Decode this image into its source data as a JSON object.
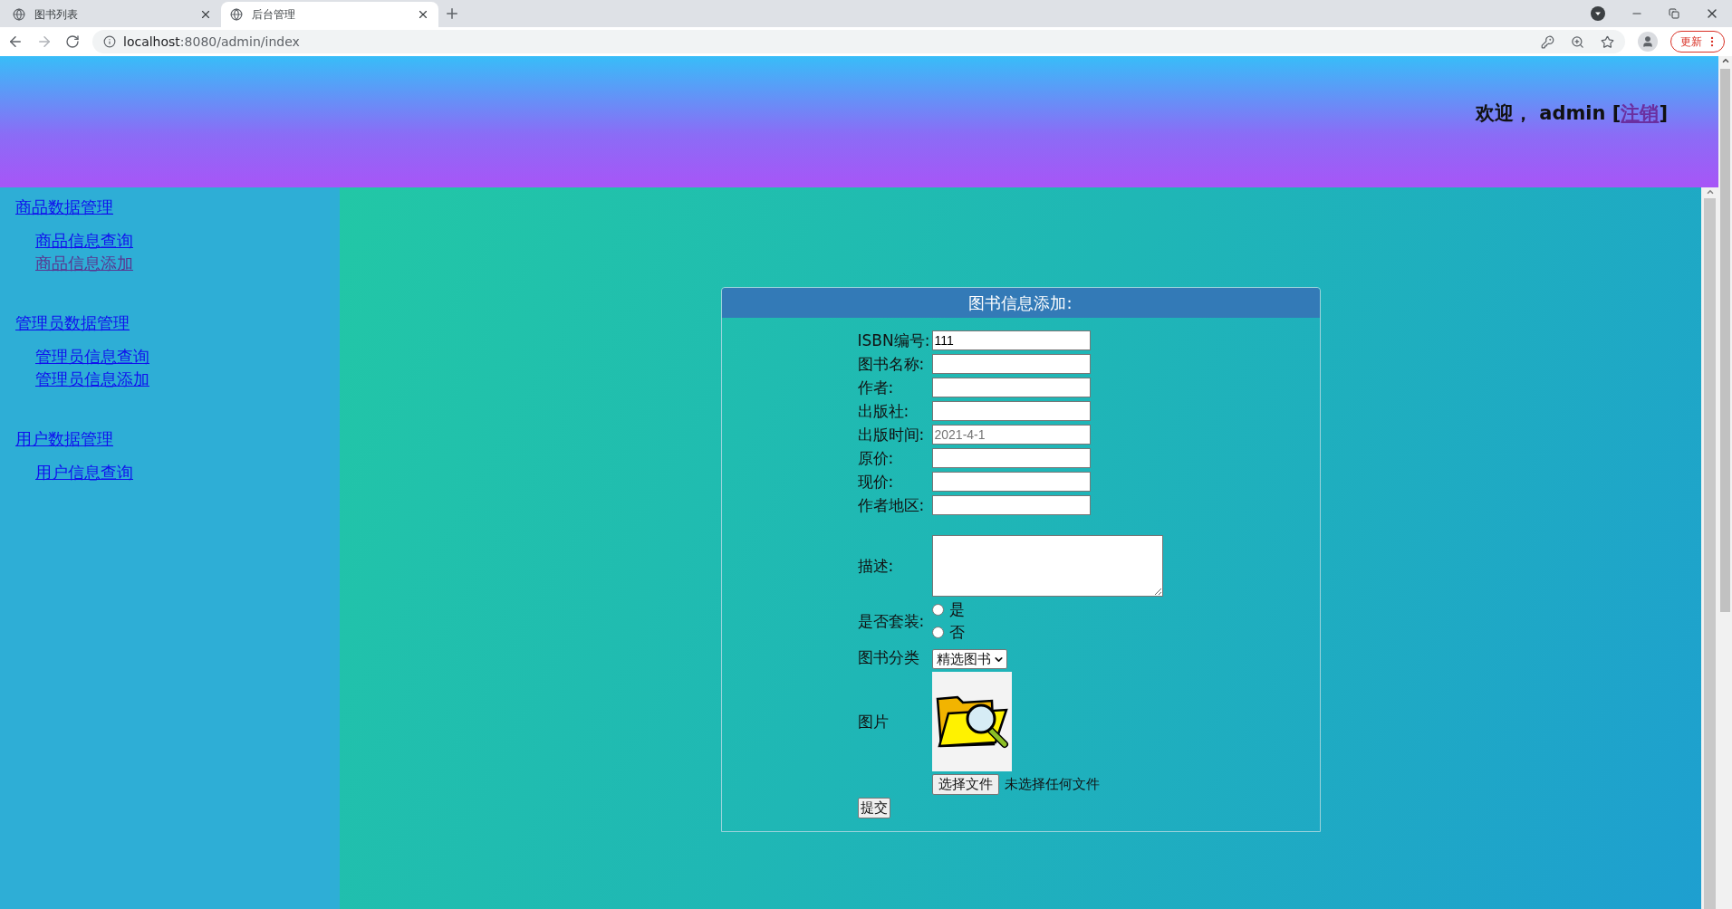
{
  "browser": {
    "tabs": [
      {
        "title": "图书列表",
        "selected": false
      },
      {
        "title": "后台管理",
        "selected": true
      }
    ],
    "url_host": "localhost",
    "url_path": ":8080/admin/index",
    "update_button": "更新"
  },
  "header": {
    "greeting_before": "欢迎， admin [",
    "logout_link": "注销",
    "greeting_after": "]"
  },
  "sidebar": {
    "groups": [
      {
        "title": "商品数据管理",
        "children": [
          {
            "label": "商品信息查询",
            "visited": false
          },
          {
            "label": "商品信息添加",
            "visited": true
          }
        ]
      },
      {
        "title": "管理员数据管理",
        "children": [
          {
            "label": "管理员信息查询",
            "visited": false
          },
          {
            "label": "管理员信息添加",
            "visited": false
          }
        ]
      },
      {
        "title": "用户数据管理",
        "children": [
          {
            "label": "用户信息查询",
            "visited": false
          }
        ]
      }
    ]
  },
  "form": {
    "title": "图书信息添加:",
    "rows": [
      {
        "kind": "text",
        "label": "ISBN编号:",
        "value": "111"
      },
      {
        "kind": "text",
        "label": "图书名称:"
      },
      {
        "kind": "text",
        "label": "作者:"
      },
      {
        "kind": "text",
        "label": "出版社:"
      },
      {
        "kind": "text",
        "label": "出版时间:",
        "placeholder": "2021-4-1"
      },
      {
        "kind": "text",
        "label": "原价:"
      },
      {
        "kind": "text",
        "label": "现价:"
      },
      {
        "kind": "text",
        "label": "作者地区:"
      },
      {
        "kind": "textarea",
        "label": "描述:"
      },
      {
        "kind": "radio",
        "label": "是否套装:",
        "options": [
          {
            "label": "是",
            "selected": false
          },
          {
            "label": "否",
            "selected": false
          }
        ]
      },
      {
        "kind": "select",
        "label": "图书分类",
        "value": "精选图书"
      },
      {
        "kind": "image",
        "label": "图片"
      },
      {
        "kind": "file",
        "button": "选择文件",
        "status": "未选择任何文件"
      }
    ],
    "submit": "提交"
  }
}
